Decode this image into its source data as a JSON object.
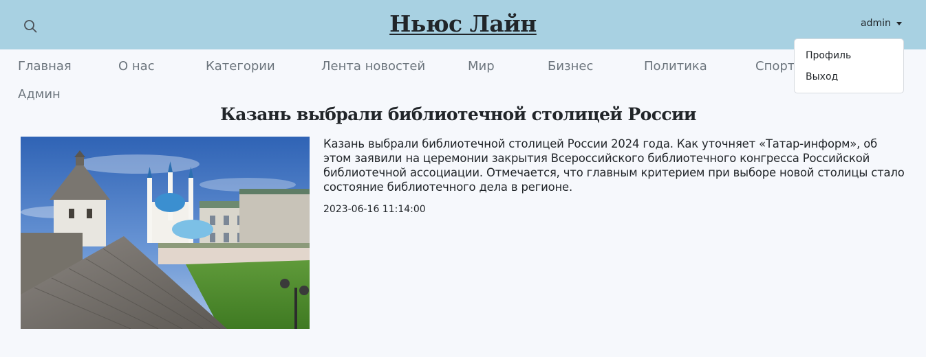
{
  "header": {
    "brand": "Ньюс Лайн",
    "search_icon": "search-icon",
    "user": "admin"
  },
  "user_dropdown": {
    "items": [
      "Профиль",
      "Выход"
    ]
  },
  "nav": {
    "items": [
      "Главная",
      "О нас",
      "Категории",
      "Лента новостей",
      "Мир",
      "Бизнес",
      "Политика",
      "Спорт",
      "Админ"
    ]
  },
  "article": {
    "title": "Казань выбрали библиотечной столицей России",
    "text": "Казань выбрали библиотечной столицей России 2024 года. Как уточняет «Татар-информ», об этом заявили на церемонии закрытия Всероссийского библиотечного конгресса Российской библиотечной ассоциации. Отмечается, что главным критерием при выборе новой столицы стало состояние библиотечного дела в регионе.",
    "date": "2023-06-16 11:14:00",
    "image": "kazan-kremlin-photo"
  },
  "colors": {
    "header_bg": "#a8d1e2",
    "page_bg": "#f6f8fc",
    "nav_text": "#6c757d",
    "text": "#212529"
  }
}
